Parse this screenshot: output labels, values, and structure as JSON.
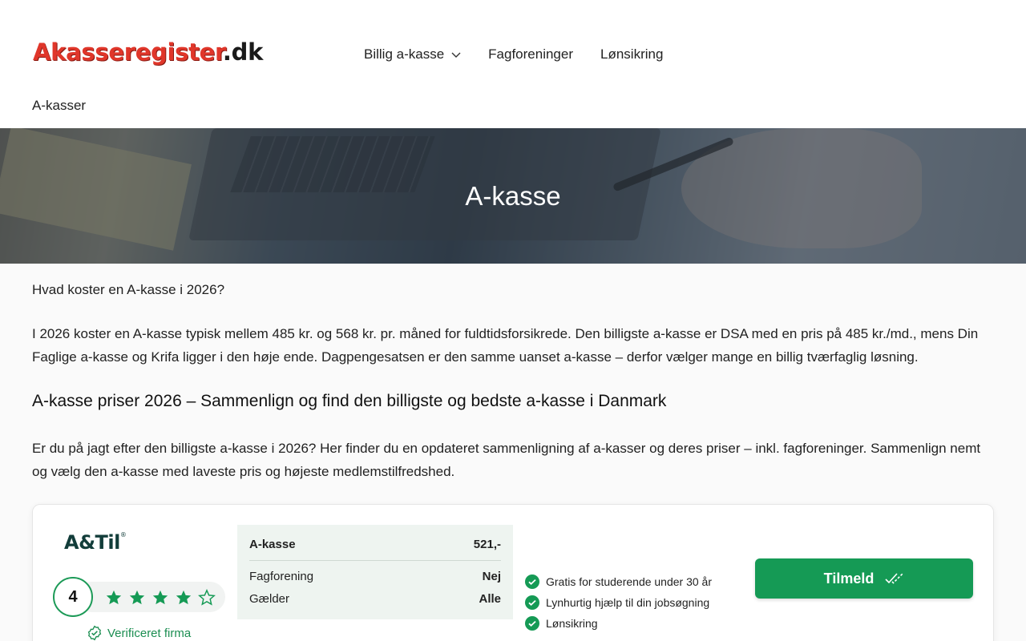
{
  "header": {
    "logo_main": "Akasseregister",
    "logo_tld": ".dk",
    "nav": [
      {
        "label": "Billig a-kasse",
        "has_dropdown": true
      },
      {
        "label": "Fagforeninger",
        "has_dropdown": false
      },
      {
        "label": "Lønsikring",
        "has_dropdown": false
      }
    ],
    "nav_row2": "A-kasser"
  },
  "hero": {
    "title": "A-kasse"
  },
  "main": {
    "question": "Hvad koster en A-kasse i 2026?",
    "intro": "I 2026 koster en A-kasse typisk mellem 485 kr. og 568 kr. pr. måned for fuldtidsforsikrede. Den billigste a-kasse er DSA med en pris på 485 kr./md., mens Din Faglige a-kasse og Krifa ligger i den høje ende. Dagpengesatsen er den samme uanset a-kasse – derfor vælger mange en billig tværfaglig løsning.",
    "heading": "A-kasse priser 2026 – Sammenlign og find den billigste og bedste a-kasse i Danmark",
    "body": "Er du på jagt efter den billigste a-kasse i 2026? Her finder du en opdateret sammenligning af a-kasser og deres priser – inkl. fagforeninger. Sammenlign nemt og vælg den a-kasse med laveste pris og højeste medlemstilfredshed."
  },
  "card": {
    "brand": "A&Til",
    "brand_mark": "®",
    "rating": "4",
    "stars_filled": 4,
    "stars_total": 5,
    "verified": "Verificeret firma",
    "price_rows": [
      {
        "label": "A-kasse",
        "value": "521,-"
      },
      {
        "label": "Fagforening",
        "value": "Nej"
      },
      {
        "label": "Gælder",
        "value": "Alle"
      }
    ],
    "features": [
      "Gratis for studerende under 30 år",
      "Lynhurtig hjælp til din jobsøgning",
      "Lønsikring"
    ],
    "cta": "Tilmeld"
  },
  "colors": {
    "accent_green": "#159a55",
    "logo_red": "#e0362a"
  }
}
